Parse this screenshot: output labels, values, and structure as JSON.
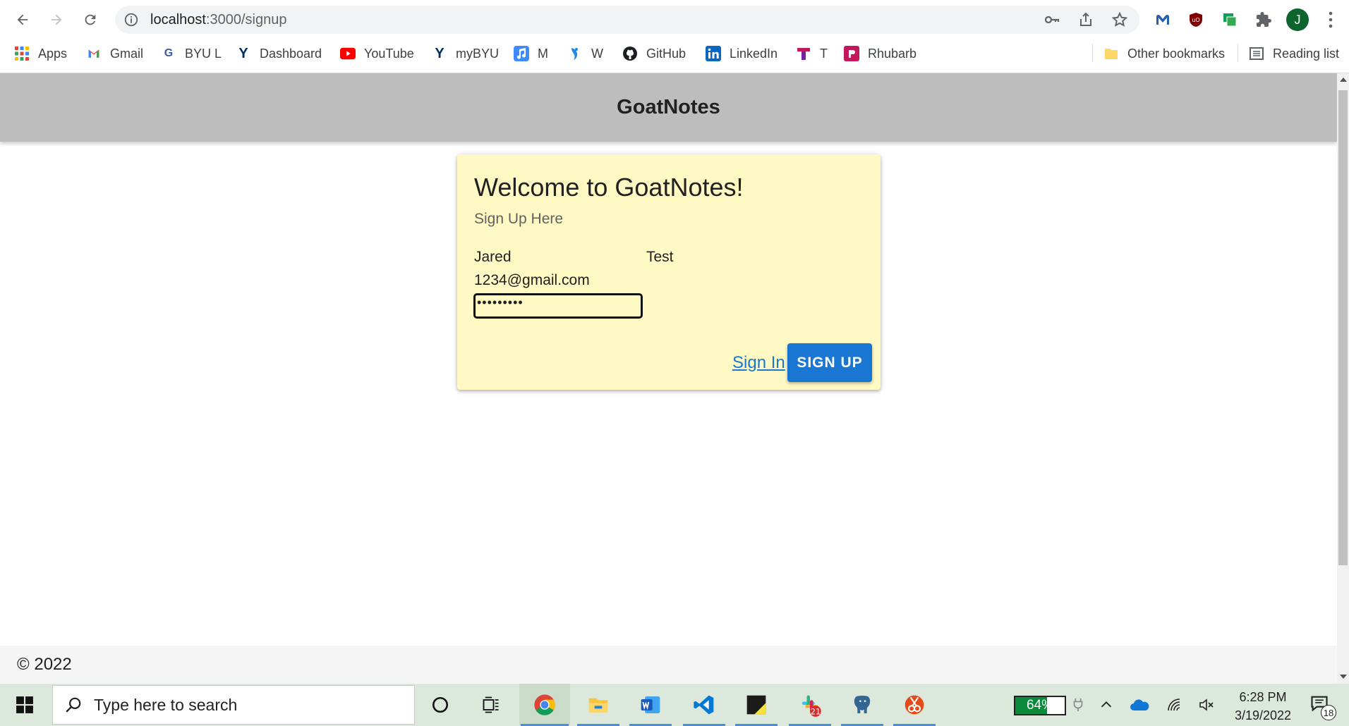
{
  "browser": {
    "url_host": "localhost",
    "url_path": ":3000/signup",
    "bookmarks": [
      {
        "label": "Apps",
        "icon": "apps-grid-icon"
      },
      {
        "label": "Gmail",
        "icon": "gmail-icon"
      },
      {
        "label": "BYU L",
        "icon": "byu-learning-icon"
      },
      {
        "label": "Dashboard",
        "icon": "byu-y-icon"
      },
      {
        "label": "YouTube",
        "icon": "youtube-icon"
      },
      {
        "label": "myBYU",
        "icon": "byu-y-icon"
      },
      {
        "label": "M",
        "icon": "music-icon"
      },
      {
        "label": "W",
        "icon": "bird-icon"
      },
      {
        "label": "GitHub",
        "icon": "github-icon"
      },
      {
        "label": "LinkedIn",
        "icon": "linkedin-icon"
      },
      {
        "label": "T",
        "icon": "t-logo-icon"
      },
      {
        "label": "Rhubarb",
        "icon": "rhubarb-icon"
      }
    ],
    "other_bookmarks": "Other bookmarks",
    "reading_list": "Reading list",
    "profile_initial": "J"
  },
  "app": {
    "title": "GoatNotes"
  },
  "signup_card": {
    "title": "Welcome to GoatNotes!",
    "subtitle": "Sign Up Here",
    "first_name": "Jared",
    "last_name": "Test",
    "email": "1234@gmail.com",
    "password_masked": "•••••••••",
    "signin_link": "Sign In",
    "signup_button": "SIGN UP"
  },
  "footer": {
    "text": "© 2022"
  },
  "taskbar": {
    "search_placeholder": "Type here to search",
    "battery_percent": "64%",
    "battery_level": 0.64,
    "time": "6:28 PM",
    "date": "3/19/2022",
    "slack_badge": "21",
    "notification_count": "18"
  },
  "colors": {
    "appbar": "#bdbdbd",
    "card": "#fff9c4",
    "primary": "#1976d2",
    "taskbar": "#dde8dd"
  }
}
